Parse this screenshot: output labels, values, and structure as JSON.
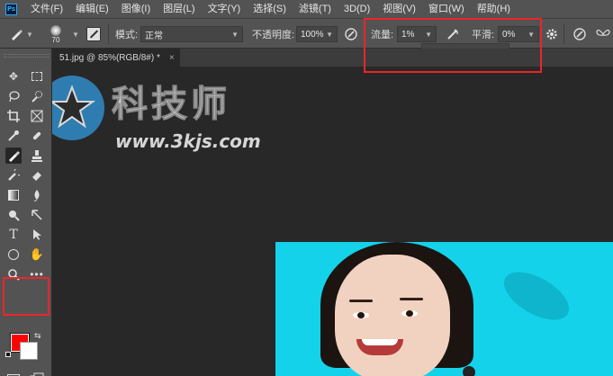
{
  "app_icon": "Ps",
  "menu": [
    "文件(F)",
    "编辑(E)",
    "图像(I)",
    "图层(L)",
    "文字(Y)",
    "选择(S)",
    "滤镜(T)",
    "3D(D)",
    "视图(V)",
    "窗口(W)",
    "帮助(H)"
  ],
  "options": {
    "brush_size": "70",
    "mode_label": "模式:",
    "mode_value": "正常",
    "opacity_label": "不透明度:",
    "opacity_value": "100%",
    "flow_label": "流量:",
    "flow_value": "1%",
    "smoothing_label": "平滑:",
    "smoothing_value": "0%",
    "flow_slider_fraction": 0.01
  },
  "document_tab": {
    "title": "51.jpg @ 85%(RGB/8#) *",
    "close": "×"
  },
  "watermark": {
    "title": "科技师",
    "url": "www.3kjs.com"
  },
  "colors": {
    "foreground": "#ff0000",
    "background": "#ffffff",
    "highlight": "#e8262b"
  },
  "tools": [
    "move-icon",
    "marquee-icon",
    "lasso-icon",
    "quick-select-icon",
    "crop-icon",
    "frame-icon",
    "eyedropper-icon",
    "healing-icon",
    "brush-icon",
    "stamp-icon",
    "history-brush-icon",
    "eraser-icon",
    "gradient-icon",
    "blur-icon",
    "dodge-icon",
    "pen-icon",
    "type-icon",
    "path-select-icon",
    "ellipse-icon",
    "hand-icon",
    "zoom-icon",
    "more-icon",
    "quick-mask-icon",
    "screen-mode-icon"
  ]
}
